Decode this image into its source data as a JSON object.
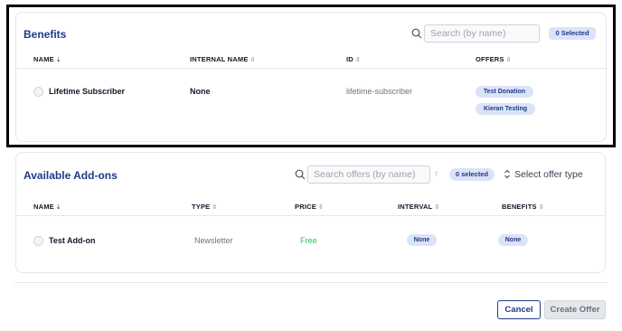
{
  "benefits": {
    "title": "Benefits",
    "search_placeholder": "Search (by name)",
    "selected_badge": "0 Selected",
    "columns": [
      {
        "label": "NAME",
        "sort": "⇣"
      },
      {
        "label": "INTERNAL NAME",
        "sort": "⇳"
      },
      {
        "label": "ID",
        "sort": "⇳"
      },
      {
        "label": "OFFERS",
        "sort": "⇳"
      }
    ],
    "rows": [
      {
        "name": "Lifetime Subscriber",
        "internal_name": "None",
        "id": "lifetime-subscriber",
        "offers": [
          "Test Donation",
          "Kieran Testing"
        ]
      }
    ]
  },
  "addons": {
    "title": "Available Add-ons",
    "search_placeholder": "Search offers (by name)",
    "sort_arrow": "↑",
    "selected_badge": "0 selected",
    "select_type": "Select offer type",
    "columns": [
      {
        "label": "NAME",
        "sort": "⇣"
      },
      {
        "label": "TYPE",
        "sort": "⇳"
      },
      {
        "label": "PRICE",
        "sort": "⇳"
      },
      {
        "label": "INTERVAL",
        "sort": "⇳"
      },
      {
        "label": "BENEFITS",
        "sort": "⇳"
      }
    ],
    "rows": [
      {
        "name": "Test Add-on",
        "type": "Newsletter",
        "price": "Free",
        "interval": "None",
        "benefits": "None"
      }
    ]
  },
  "footer": {
    "cancel_label": "Cancel",
    "create_label": "Create Offer"
  },
  "colors": {
    "accent": "#1e3a8a",
    "badge_bg": "#dbe3f6",
    "free": "#22c55e",
    "frame": "#000000"
  }
}
